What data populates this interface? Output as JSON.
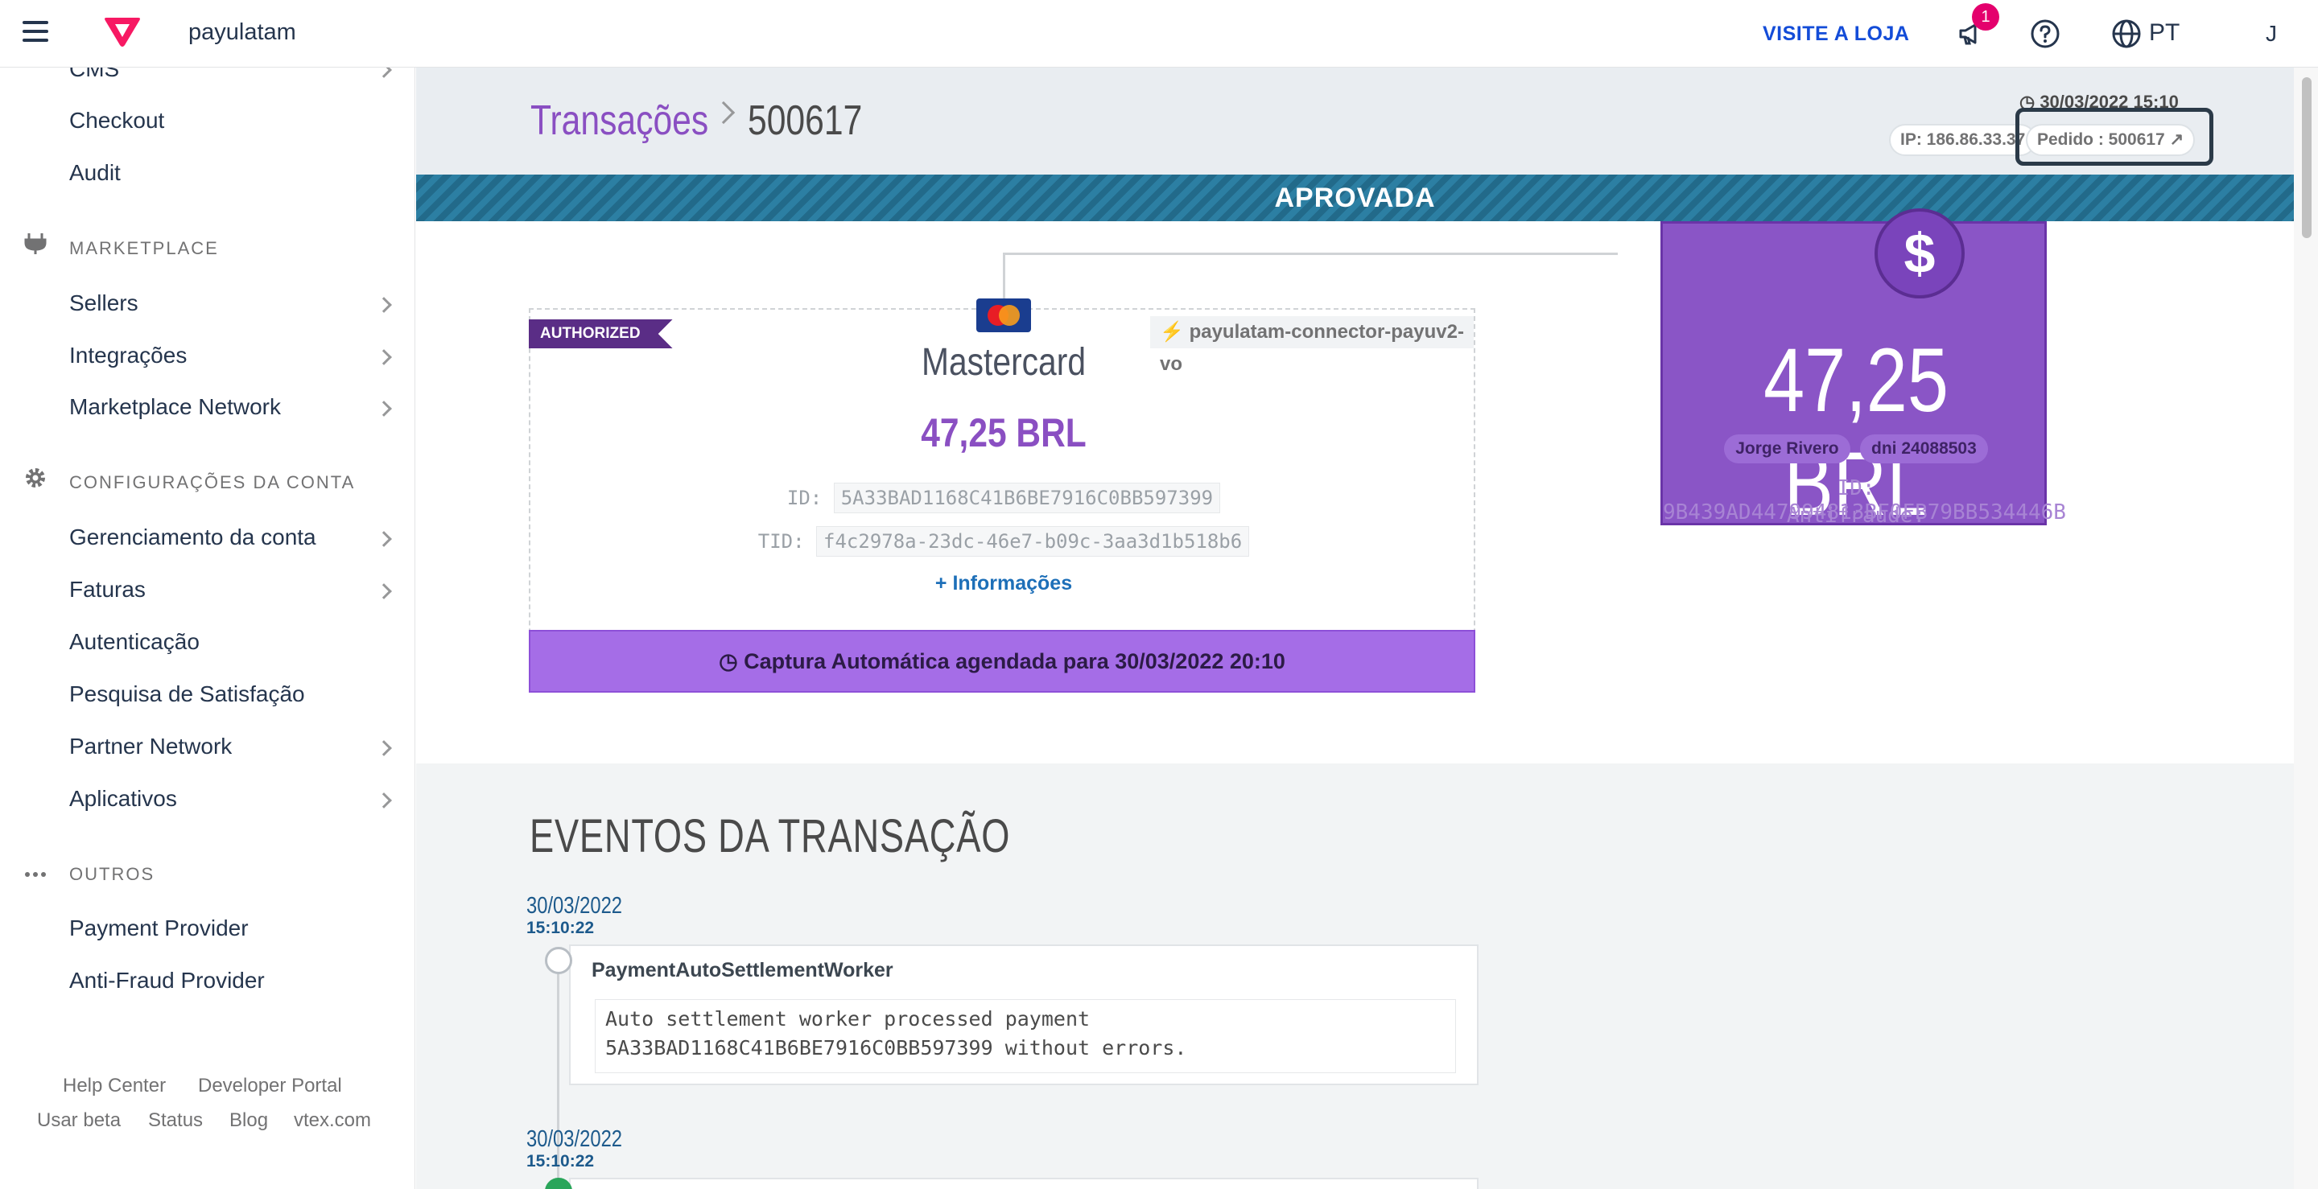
{
  "topbar": {
    "account_name": "payulatam",
    "visit_store": "VISITE A LOJA",
    "notification_count": "1",
    "language": "PT",
    "user_initial": "J"
  },
  "sidebar": {
    "items_top": [
      {
        "label": "CMS"
      },
      {
        "label": "Checkout"
      },
      {
        "label": "Audit"
      }
    ],
    "marketplace_section": "MARKETPLACE",
    "marketplace_items": [
      {
        "label": "Sellers"
      },
      {
        "label": "Integrações"
      },
      {
        "label": "Marketplace Network"
      }
    ],
    "account_section": "CONFIGURAÇÕES DA CONTA",
    "account_items": [
      {
        "label": "Gerenciamento da conta"
      },
      {
        "label": "Faturas"
      },
      {
        "label": "Autenticação"
      },
      {
        "label": "Pesquisa de Satisfação"
      },
      {
        "label": "Partner Network"
      },
      {
        "label": "Aplicativos"
      }
    ],
    "other_section": "OUTROS",
    "other_items": [
      {
        "label": "Payment Provider"
      },
      {
        "label": "Anti-Fraud Provider"
      }
    ],
    "footer": {
      "help_center": "Help Center",
      "developer_portal": "Developer Portal",
      "use_beta": "Usar beta",
      "status": "Status",
      "blog": "Blog",
      "vtex": "vtex.com"
    }
  },
  "transaction": {
    "breadcrumb_root": "Transações",
    "breadcrumb_current": "500617",
    "timestamp": "30/03/2022 15:10",
    "ip": "IP: 186.86.33.37",
    "order": "Pedido : 500617",
    "status": "APROVADA",
    "payment": {
      "tag": "AUTHORIZED",
      "connector": "payulatam-connector-payuv2-vo",
      "method": "Mastercard",
      "amount": "47,25 BRL",
      "id_label": "ID:",
      "id_value": "5A33BAD1168C41B6BE7916C0BB597399",
      "tid_label": "TID:",
      "tid_value": "f4c2978a-23dc-46e7-b09c-3aa3d1b518b6",
      "more_info": "Informações",
      "capture": "Captura Automática agendada para 30/03/2022 20:10"
    },
    "summary": {
      "amount": "47,25 BRL",
      "buyer": "Jorge Rivero",
      "document": "dni 24088503",
      "id_line": "ID: 9B439AD447994813BF0FB79BB534446B",
      "antifraud_line": "Antifraude:"
    }
  },
  "events": {
    "title": "EVENTOS DA TRANSAÇÃO",
    "items": [
      {
        "date": "30/03/2022",
        "time": "15:10:22",
        "title": "PaymentAutoSettlementWorker",
        "message_line1": "Auto settlement worker processed payment",
        "message_line2": "5A33BAD1168C41B6BE7916C0BB597399 without errors."
      },
      {
        "date": "30/03/2022",
        "time": "15:10:22"
      }
    ]
  }
}
